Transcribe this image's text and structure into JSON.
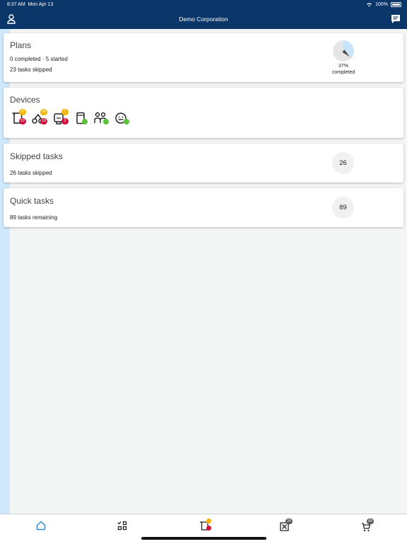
{
  "status_bar": {
    "time": "8:37 AM",
    "date": "Mon Apr 13",
    "battery": "100%"
  },
  "header": {
    "title": "Demo Corporation",
    "left_icon": "user-icon",
    "right_icon": "chat-icon"
  },
  "plans": {
    "title": "Plans",
    "summary": "0 completed · 5 started",
    "skipped": "23 tasks skipped",
    "progress_percent": 37,
    "progress_label": "37%",
    "progress_caption": "completed"
  },
  "devices": {
    "title": "Devices",
    "items": [
      {
        "icon": "printer-icon",
        "badge_top": "31",
        "badge_bottom": "22",
        "status": ""
      },
      {
        "icon": "scanner-icon",
        "badge_top": "36",
        "badge_bottom": "19",
        "status": ""
      },
      {
        "icon": "label-printer-icon",
        "badge_top": "1",
        "badge_bottom": "2",
        "status": ""
      },
      {
        "icon": "scale-icon",
        "badge_top": "",
        "badge_bottom": "",
        "status": "ok"
      },
      {
        "icon": "people-icon",
        "badge_top": "",
        "badge_bottom": "",
        "status": "ok"
      },
      {
        "icon": "face-icon",
        "badge_top": "",
        "badge_bottom": "",
        "status": "ok"
      }
    ]
  },
  "skipped_tasks": {
    "title": "Skipped tasks",
    "subtitle": "26 tasks skipped",
    "count": "26"
  },
  "quick_tasks": {
    "title": "Quick tasks",
    "subtitle": "89 tasks remaining",
    "count": "89"
  },
  "tabbar": {
    "tabs": [
      {
        "icon": "home-icon",
        "badge": ""
      },
      {
        "icon": "checklist-icon",
        "badge": ""
      },
      {
        "icon": "printer-icon",
        "badge": ""
      },
      {
        "icon": "skip-icon",
        "badge": "26"
      },
      {
        "icon": "cart-icon",
        "badge": "89"
      }
    ]
  },
  "colors": {
    "header": "#0a3669",
    "accent": "#2a8bd6",
    "yellow": "#f4b400",
    "red": "#d0103a",
    "green": "#5cc23c"
  }
}
